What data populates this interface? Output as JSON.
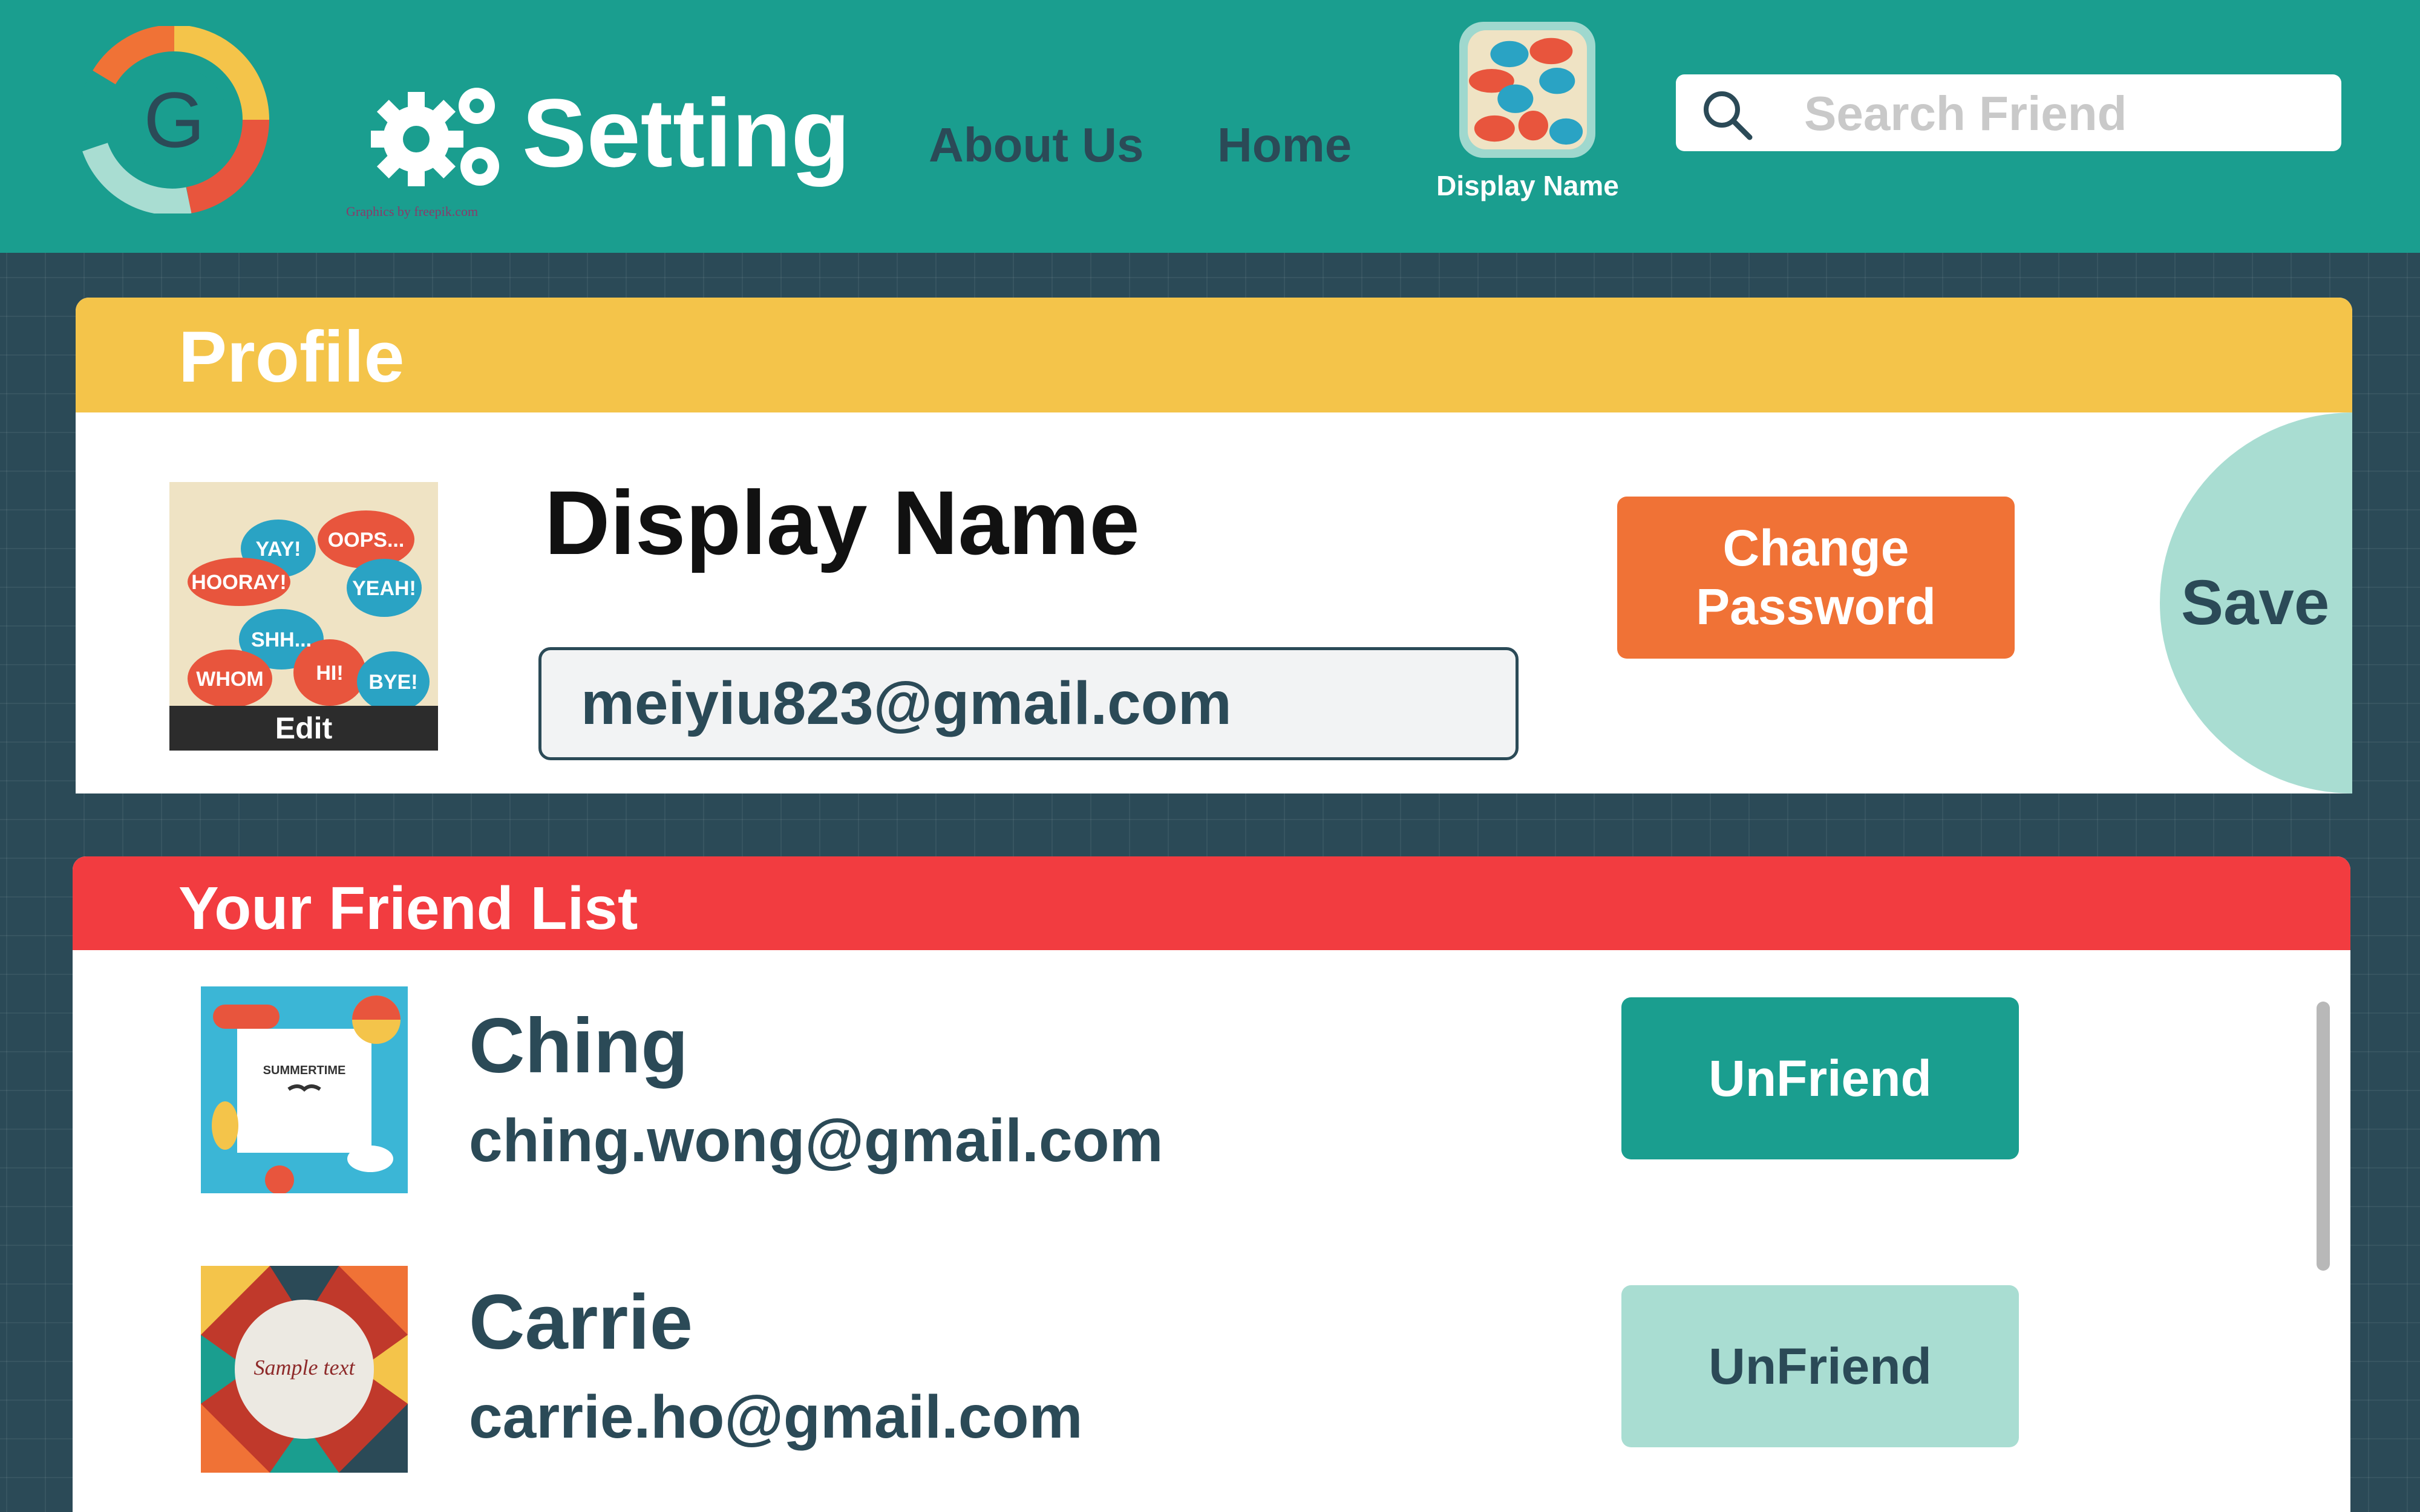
{
  "header": {
    "app_logo": "G",
    "title": "Setting",
    "caption": "Graphics by freepik.com",
    "nav": [
      {
        "label": "About Us"
      },
      {
        "label": "Home"
      }
    ],
    "user_display_name": "Display Name",
    "search": {
      "placeholder": "Search Friend",
      "value": ""
    }
  },
  "profile": {
    "section_title": "Profile",
    "avatar_edit_label": "Edit",
    "display_name": "Display Name",
    "email": "meiyiu823@gmail.com",
    "change_password_label": "Change\nPassword",
    "save_label": "Save",
    "bubble_words": [
      "YAY!",
      "OOPS...",
      "HOORAY!",
      "YEAH!",
      "SHH...",
      "WHOM",
      "HI!",
      "BYE!"
    ]
  },
  "friends": {
    "section_title": "Your Friend List",
    "items": [
      {
        "name": "Ching",
        "email": "ching.wong@gmail.com",
        "unfriend_label": "UnFriend",
        "avatar_text": "SUMMERTIME"
      },
      {
        "name": "Carrie",
        "email": "carrie.ho@gmail.com",
        "unfriend_label": "UnFriend",
        "avatar_text": "Sample text"
      }
    ]
  },
  "colors": {
    "header_bg": "#1a9e8f",
    "page_bg": "#2b4a57",
    "profile_header": "#f4c44a",
    "friends_header": "#f23c40",
    "change_password": "#f07236",
    "save": "#a9ddd2",
    "unfriend_primary": "#1a9e8f",
    "unfriend_secondary": "#a9ddd2"
  }
}
